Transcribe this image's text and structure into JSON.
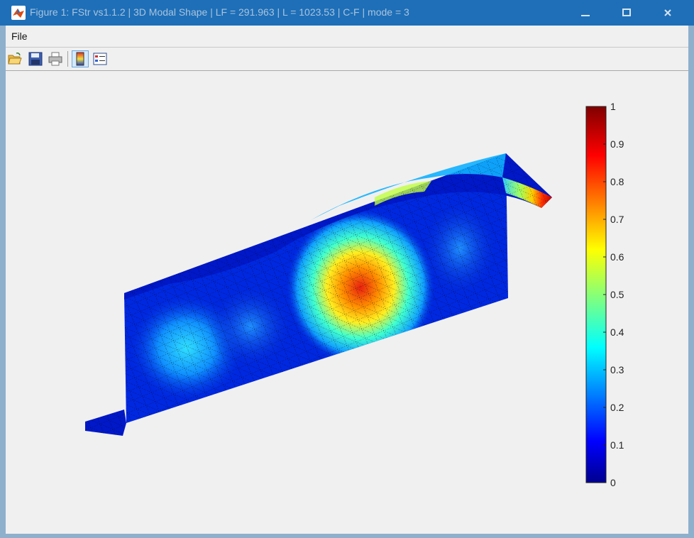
{
  "window": {
    "title": "Figure 1: FStr vs1.1.2 | 3D Modal Shape | LF = 291.963 | L = 1023.53 | C-F | mode = 3",
    "buttons": {
      "minimize": "minimize-icon",
      "maximize": "maximize-icon",
      "close": "close-icon"
    }
  },
  "menu": {
    "items": [
      {
        "label": "File"
      }
    ]
  },
  "toolbar": {
    "tools": [
      {
        "name": "open-file",
        "icon": "folder-open-icon"
      },
      {
        "name": "save",
        "icon": "floppy-disk-icon"
      },
      {
        "name": "print",
        "icon": "printer-icon"
      },
      {
        "name": "toggle-colorbar",
        "icon": "colorbar-icon",
        "pressed": true
      },
      {
        "name": "toggle-legend",
        "icon": "legend-icon",
        "pressed": false
      }
    ]
  },
  "chart_data": {
    "type": "heatmap",
    "colormap": "jet",
    "colorbar": {
      "range": [
        0,
        1
      ],
      "ticks": [
        0,
        0.1,
        0.2,
        0.3,
        0.4,
        0.5,
        0.6,
        0.7,
        0.8,
        0.9,
        1
      ],
      "tick_labels": [
        "0",
        "0.1",
        "0.2",
        "0.3",
        "0.4",
        "0.5",
        "0.6",
        "0.7",
        "0.8",
        "0.9",
        "1"
      ],
      "placement": "right"
    },
    "axes_visible": false,
    "mesh": "triangulated 3D surface with dotted black edges"
  }
}
